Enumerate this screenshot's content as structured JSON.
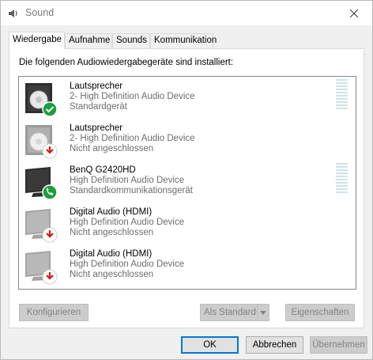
{
  "window": {
    "title": "Sound",
    "app_icon": "speaker-icon",
    "close_icon": "close-icon"
  },
  "tabs": [
    {
      "label": "Wiedergabe",
      "active": true
    },
    {
      "label": "Aufnahme",
      "active": false
    },
    {
      "label": "Sounds",
      "active": false
    },
    {
      "label": "Kommunikation",
      "active": false
    }
  ],
  "panel": {
    "instruction": "Die folgenden Audiowiedergabegeräte sind installiert:",
    "devices": [
      {
        "name": "Lautsprecher",
        "line2": "2- High Definition Audio Device",
        "line3": "Standardgerät",
        "icon": "speaker-icon",
        "badge": "check-badge-icon",
        "meter": true
      },
      {
        "name": "Lautsprecher",
        "line2": "2- High Definition Audio Device",
        "line3": "Nicht angeschlossen",
        "icon": "speaker-icon",
        "badge": "unplugged-badge-icon",
        "meter": false
      },
      {
        "name": "BenQ G2420HD",
        "line2": "High Definition Audio Device",
        "line3": "Standardkommunikationsgerät",
        "icon": "monitor-icon",
        "badge": "phone-badge-icon",
        "meter": true
      },
      {
        "name": "Digital Audio (HDMI)",
        "line2": "High Definition Audio Device",
        "line3": "Nicht angeschlossen",
        "icon": "monitor-icon",
        "badge": "unplugged-badge-icon",
        "meter": false
      },
      {
        "name": "Digital Audio (HDMI)",
        "line2": "High Definition Audio Device",
        "line3": "Nicht angeschlossen",
        "icon": "monitor-icon",
        "badge": "unplugged-badge-icon",
        "meter": false
      }
    ],
    "buttons": {
      "configure": "Konfigurieren",
      "set_default": "Als Standard",
      "properties": "Eigenschaften"
    }
  },
  "footer": {
    "ok": "OK",
    "cancel": "Abbrechen",
    "apply": "Übernehmen"
  },
  "colors": {
    "success": "#1e9e3a",
    "error": "#d7191a",
    "meter": "#cde3ea",
    "focus": "#0078d7"
  }
}
